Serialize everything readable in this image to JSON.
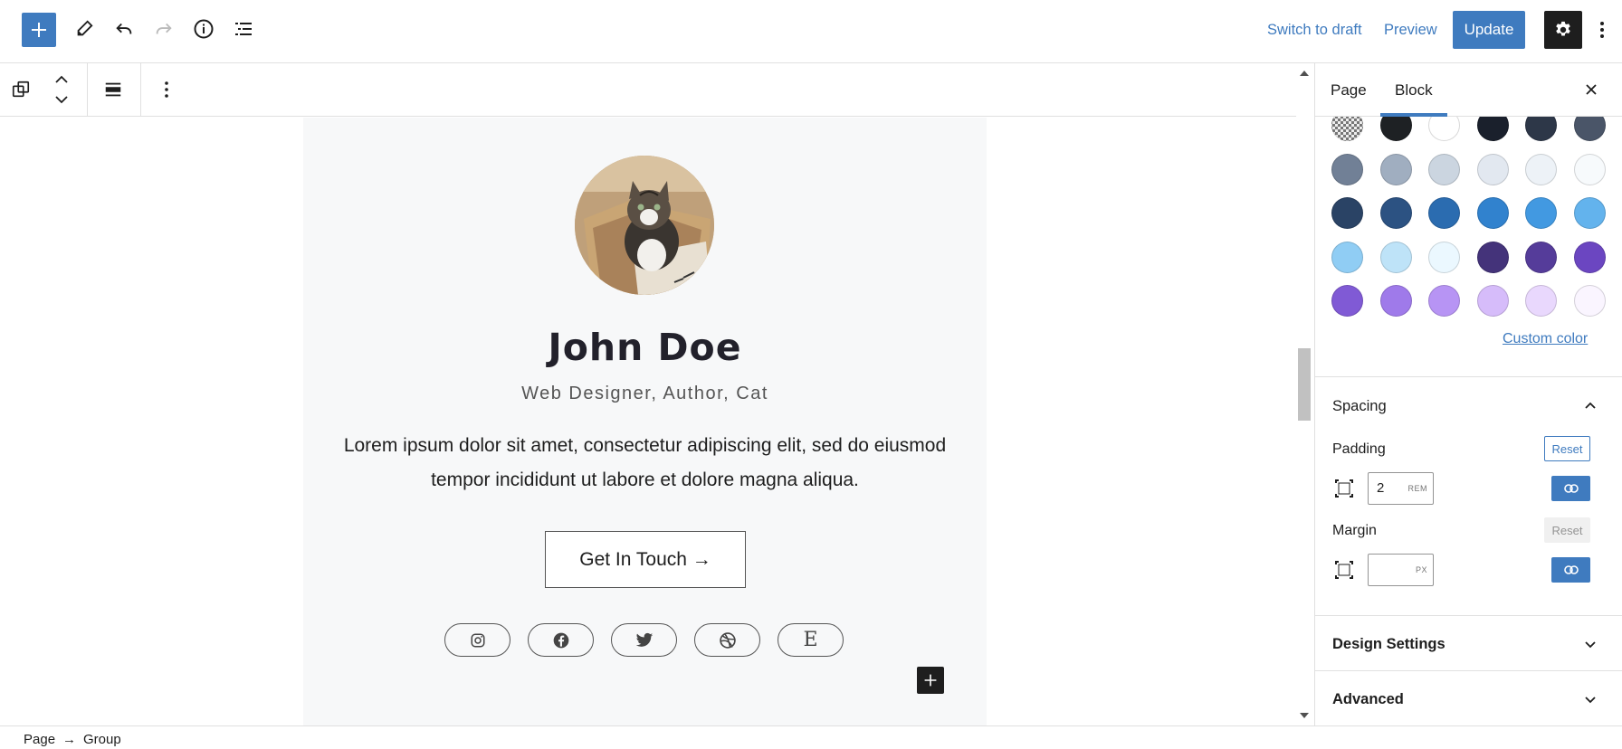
{
  "topbar": {
    "switch_draft_label": "Switch to draft",
    "preview_label": "Preview",
    "update_label": "Update"
  },
  "profile": {
    "name": "John Doe",
    "tagline": "Web Designer, Author, Cat",
    "bio": "Lorem ipsum dolor sit amet, consectetur adipiscing elit, sed do eiusmod tempor incididunt ut labore et dolore magna aliqua.",
    "cta_label": "Get In Touch →",
    "social_icons": [
      "instagram-icon",
      "facebook-icon",
      "twitter-icon",
      "dribbble-icon",
      "etsy-icon"
    ],
    "etsy_glyph": "E"
  },
  "sidebar": {
    "tabs": [
      {
        "label": "Page",
        "active": false
      },
      {
        "label": "Block",
        "active": true
      }
    ],
    "palette": [
      [
        "#d0d0d0",
        "#1e2124",
        "#ffffff",
        "#1a202c",
        "#2d3748",
        "#4a5568"
      ],
      [
        "#718096",
        "#a0aec0",
        "#cbd5e0",
        "#e2e8f0",
        "#edf2f7",
        "#f7fafc"
      ],
      [
        "#2a4365",
        "#2c5282",
        "#2b6cb0",
        "#3182ce",
        "#4299e1",
        "#63b3ed"
      ],
      [
        "#90cdf4",
        "#bee3f8",
        "#ebf8ff",
        "#44337a",
        "#553c9a",
        "#6b46c1"
      ],
      [
        "#805ad5",
        "#9f7aea",
        "#b794f4",
        "#d6bcfa",
        "#e9d8fd",
        "#faf5ff"
      ]
    ],
    "custom_color_label": "Custom color",
    "spacing": {
      "title": "Spacing",
      "padding_label": "Padding",
      "padding_reset": "Reset",
      "padding_value": "2",
      "padding_unit": "REM",
      "margin_label": "Margin",
      "margin_reset": "Reset",
      "margin_value": "",
      "margin_unit": "PX"
    },
    "design_settings_title": "Design Settings",
    "advanced_title": "Advanced"
  },
  "breadcrumb": {
    "items": [
      "Page",
      "Group"
    ],
    "separator": "→"
  },
  "colors": {
    "accent": "#3f7bbf",
    "dark": "#1e1e1e"
  }
}
